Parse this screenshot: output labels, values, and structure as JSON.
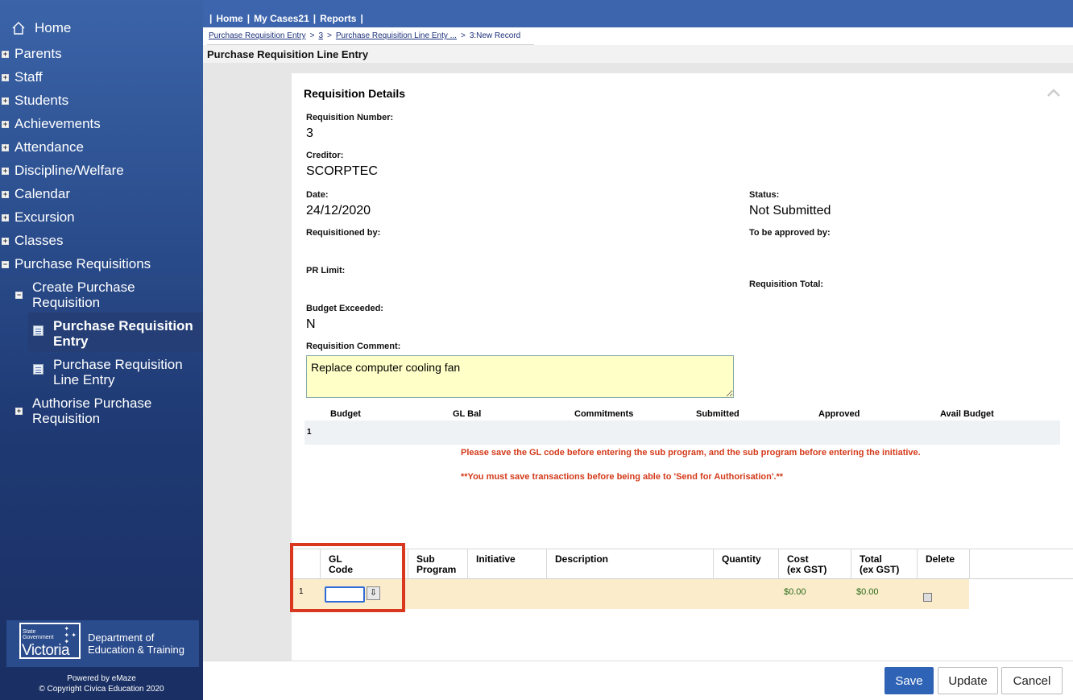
{
  "sidebar": {
    "home": "Home",
    "items": [
      "Parents",
      "Staff",
      "Students",
      "Achievements",
      "Attendance",
      "Discipline/Welfare",
      "Calendar",
      "Excursion",
      "Classes",
      "Purchase Requisitions"
    ],
    "sub_create": "Create Purchase Requisition",
    "sub_entry": "Purchase Requisition Entry",
    "sub_line_entry": "Purchase Requisition Line Entry",
    "sub_authorise": "Authorise Purchase Requisition",
    "logo_small": "State Government",
    "logo_big": "Victoria",
    "dept": "Department of Education & Training",
    "powered": "Powered by eMaze",
    "copyright": "© Copyright Civica Education 2020"
  },
  "topnav": [
    "Home",
    "My Cases21",
    "Reports"
  ],
  "breadcrumb": {
    "c1": "Purchase Requisition Entry",
    "c2": "3",
    "c3": "Purchase Requisition Line Enty ...",
    "c4": "3:New Record",
    "separator": ">"
  },
  "page_title": "Purchase Requisition Line Entry",
  "details": {
    "title": "Requisition Details",
    "req_number_label": "Requisition Number:",
    "req_number": "3",
    "creditor_label": "Creditor:",
    "creditor": "SCORPTEC",
    "date_label": "Date:",
    "date": "24/12/2020",
    "status_label": "Status:",
    "status": "Not Submitted",
    "requisitioned_label": "Requisitioned by:",
    "approver_label": "To be approved by:",
    "pr_limit_label": "PR Limit:",
    "total_label": "Requisition Total:",
    "budget_exceeded_label": "Budget Exceeded:",
    "budget_exceeded": "N",
    "comment_label": "Requisition Comment:",
    "comment": "Replace computer cooling fan"
  },
  "budget": {
    "headers": [
      "Budget",
      "GL Bal",
      "Commitments",
      "Submitted",
      "Approved",
      "Avail Budget"
    ],
    "row_number": "1"
  },
  "warnings": {
    "w1": "Please save the GL code before entering the sub program, and the sub program before entering the initiative.",
    "w2": "**You must save transactions before being able to 'Send for Authorisation'.**"
  },
  "grid": {
    "gl_code_l1": "GL",
    "gl_code_l2": "Code",
    "sub_program_l1": "Sub",
    "sub_program_l2": "Program",
    "initiative": "Initiative",
    "description": "Description",
    "quantity": "Quantity",
    "cost_l1": "Cost",
    "cost_l2": "(ex GST)",
    "total_l1": "Total",
    "total_l2": "(ex GST)",
    "delete": "Delete",
    "row_number": "1",
    "gl_value": "",
    "cost": "$0.00",
    "total": "$0.00"
  },
  "buttons": {
    "save": "Save",
    "update": "Update",
    "cancel": "Cancel"
  },
  "colors": {
    "sidebar_top": "#3b64a8",
    "sidebar_bottom": "#1a2f63",
    "topbar": "#3d65ad",
    "warning": "#d43a1a",
    "highlight": "#d9381e",
    "save_button": "#2f63b5",
    "row_bg": "#fbeccc",
    "comment_bg": "#ffffc8"
  }
}
